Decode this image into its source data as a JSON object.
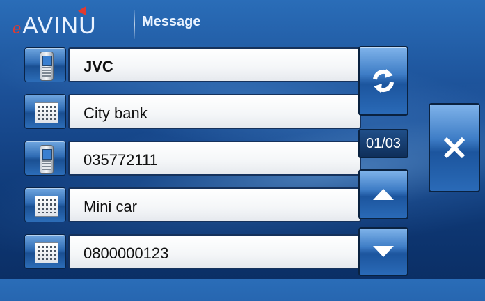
{
  "header": {
    "logo_text": "AVINU",
    "title": "Message"
  },
  "messages": [
    {
      "label": "JVC",
      "icon": "mobile-phone-icon",
      "bold": true
    },
    {
      "label": "City bank",
      "icon": "building-icon",
      "bold": false
    },
    {
      "label": "035772111",
      "icon": "mobile-phone-icon",
      "bold": false
    },
    {
      "label": "Mini car",
      "icon": "building-icon",
      "bold": false
    },
    {
      "label": "0800000123",
      "icon": "building-icon",
      "bold": false
    }
  ],
  "controls": {
    "page_indicator": "01/03",
    "refresh_icon": "refresh-icon",
    "up_icon": "arrow-up-icon",
    "down_icon": "arrow-down-icon",
    "close_icon": "close-icon"
  },
  "colors": {
    "background": "#1b4f96",
    "accent_red": "#e23a2e",
    "button_blue": "#3e7dc6"
  }
}
